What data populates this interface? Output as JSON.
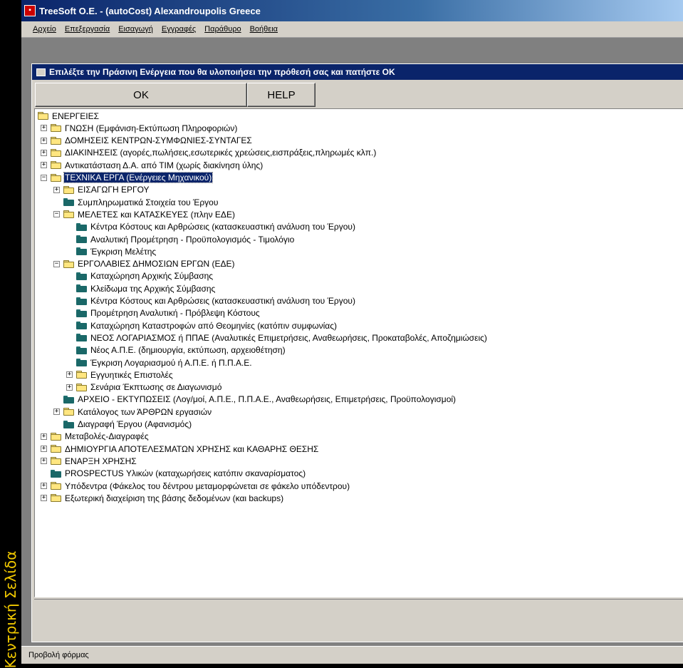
{
  "side_banner": "Κεντρική Σελίδα",
  "window": {
    "title": "TreeSoft O.E. - (autoCost) Alexandroupolis Greece"
  },
  "menu": [
    {
      "label": "Αρχείο"
    },
    {
      "label": "Επεξεργασία"
    },
    {
      "label": "Εισαγωγή"
    },
    {
      "label": "Εγγραφές"
    },
    {
      "label": "Παράθυρο"
    },
    {
      "label": "Βοήθεια"
    }
  ],
  "dialog": {
    "title": "Επιλέξτε την Πράσινη Ενέργεια που θα υλοποιήσει την πρόθεσή σας και πατήστε ΟΚ",
    "ok_label": "OK",
    "help_label": "HELP"
  },
  "tree": [
    {
      "label": "ΕΝΕΡΓΕΙΕΣ",
      "level": 0,
      "icon": "yellow",
      "expander": ""
    },
    {
      "label": "ΓΝΩΣΗ (Εμφάνιση-Εκτύπωση Πληροφοριών)",
      "level": 1,
      "icon": "yellow",
      "expander": "+"
    },
    {
      "label": "ΔΟΜΗΣΕΙΣ ΚΕΝΤΡΩΝ-ΣΥΜΦΩΝΙΕΣ-ΣΥΝΤΑΓΕΣ",
      "level": 1,
      "icon": "yellow",
      "expander": "+"
    },
    {
      "label": "ΔΙΑΚΙΝΗΣΕΙΣ (αγορές,πωλήσεις,εσωτερικές χρεώσεις,εισπράξεις,πληρωμές κλπ.)",
      "level": 1,
      "icon": "yellow",
      "expander": "+"
    },
    {
      "label": "Αντικατάσταση Δ.Α. από ΤΙΜ (χωρίς διακίνηση ύλης)",
      "level": 1,
      "icon": "yellow",
      "expander": "+"
    },
    {
      "label": "ΤΕΧΝΙΚΑ ΕΡΓΑ (Ενέργειες Μηχανικού)",
      "level": 1,
      "icon": "yellow",
      "expander": "-",
      "selected": true
    },
    {
      "label": "ΕΙΣΑΓΩΓΗ ΕΡΓΟΥ",
      "level": 2,
      "icon": "yellow",
      "expander": "+"
    },
    {
      "label": "Συμπληρωματικά Στοιχεία του Έργου",
      "level": 2,
      "icon": "teal",
      "expander": ""
    },
    {
      "label": "ΜΕΛΕΤΕΣ και ΚΑΤΑΣΚΕΥΕΣ (πλην ΕΔΕ)",
      "level": 2,
      "icon": "yellow",
      "expander": "-"
    },
    {
      "label": "Κέντρα Κόστους και Αρθρώσεις (κατασκευαστική ανάλυση του Έργου)",
      "level": 3,
      "icon": "teal",
      "expander": ""
    },
    {
      "label": "Αναλυτική Προμέτρηση - Προϋπολογισμός - Τιμολόγιο",
      "level": 3,
      "icon": "teal",
      "expander": ""
    },
    {
      "label": "Έγκριση Μελέτης",
      "level": 3,
      "icon": "teal",
      "expander": ""
    },
    {
      "label": "ΕΡΓΟΛΑΒΙΕΣ ΔΗΜΟΣΙΩΝ ΕΡΓΩΝ (ΕΔΕ)",
      "level": 2,
      "icon": "yellow",
      "expander": "-"
    },
    {
      "label": "Καταχώρηση Αρχικής Σύμβασης",
      "level": 3,
      "icon": "teal",
      "expander": ""
    },
    {
      "label": "Κλείδωμα της Αρχικής Σύμβασης",
      "level": 3,
      "icon": "teal",
      "expander": ""
    },
    {
      "label": "Κέντρα Κόστους και Αρθρώσεις (κατασκευαστική ανάλυση του Έργου)",
      "level": 3,
      "icon": "teal",
      "expander": ""
    },
    {
      "label": "Προμέτρηση Αναλυτική - Πρόβλεψη Κόστους",
      "level": 3,
      "icon": "teal",
      "expander": ""
    },
    {
      "label": "Καταχώρηση Καταστροφών από Θεομηνίες (κατόπιν συμφωνίας)",
      "level": 3,
      "icon": "teal",
      "expander": ""
    },
    {
      "label": "ΝΕΟΣ ΛΟΓΑΡΙΑΣΜΟΣ ή ΠΠΑΕ (Αναλυτικές Επιμετρήσεις, Αναθεωρήσεις, Προκαταβολές, Αποζημιώσεις)",
      "level": 3,
      "icon": "teal",
      "expander": ""
    },
    {
      "label": "Νέος Α.Π.Ε. (δημιουργία, εκτύπωση, αρχειοθέτηση)",
      "level": 3,
      "icon": "teal",
      "expander": ""
    },
    {
      "label": "Έγκριση Λογαριασμού ή Α.Π.Ε. ή Π.Π.Α.Ε.",
      "level": 3,
      "icon": "teal",
      "expander": ""
    },
    {
      "label": "Εγγυητικές Επιστολές",
      "level": 3,
      "icon": "yellow",
      "expander": "+"
    },
    {
      "label": "Σενάρια Έκπτωσης σε Διαγωνισμό",
      "level": 3,
      "icon": "yellow",
      "expander": "+"
    },
    {
      "label": "ΑΡΧΕΙΟ - ΕΚΤΥΠΩΣΕΙΣ (Λογ/μοί, Α.Π.Ε., Π.Π.Α.Ε., Αναθεωρήσεις, Επιμετρήσεις, Προϋπολογισμοί)",
      "level": 2,
      "icon": "teal",
      "expander": ""
    },
    {
      "label": "Κατάλογος των ΆΡΘΡΩΝ εργασιών",
      "level": 2,
      "icon": "yellow",
      "expander": "+"
    },
    {
      "label": "Διαγραφή Έργου (Αφανισμός)",
      "level": 2,
      "icon": "teal",
      "expander": ""
    },
    {
      "label": "Μεταβολές-Διαγραφές",
      "level": 1,
      "icon": "yellow",
      "expander": "+"
    },
    {
      "label": "ΔΗΜΙΟΥΡΓΙΑ ΑΠΟΤΕΛΕΣΜΑΤΩΝ ΧΡΗΣΗΣ και ΚΑΘΑΡΗΣ ΘΕΣΗΣ",
      "level": 1,
      "icon": "yellow",
      "expander": "+"
    },
    {
      "label": "ΕΝΑΡΞΗ ΧΡΗΣΗΣ",
      "level": 1,
      "icon": "yellow",
      "expander": "+"
    },
    {
      "label": "PROSPECTUS Υλικών (καταχωρήσεις κατόπιν σκαναρίσματος)",
      "level": 1,
      "icon": "teal",
      "expander": ""
    },
    {
      "label": "Υπόδεντρα (Φάκελος του δέντρου μεταμορφώνεται σε φάκελο υπόδεντρου)",
      "level": 1,
      "icon": "yellow",
      "expander": "+"
    },
    {
      "label": "Εξωτερική διαχείριση της βάσης δεδομένων (και backups)",
      "level": 1,
      "icon": "yellow",
      "expander": "+"
    }
  ],
  "status": {
    "text": "Προβολή φόρμας"
  }
}
